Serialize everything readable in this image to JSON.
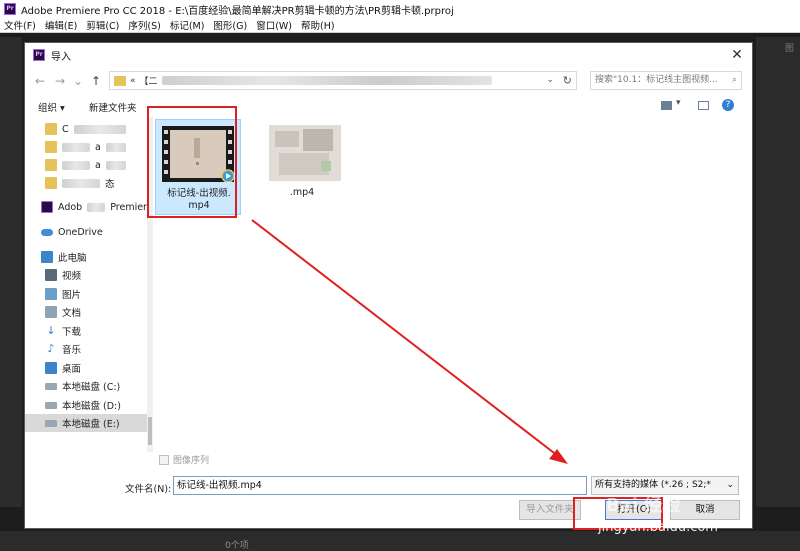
{
  "app": {
    "title": "Adobe Premiere Pro CC 2018 - E:\\百度经验\\最简单解决PR剪辑卡顿的方法\\PR剪辑卡顿.prproj",
    "logo_text": "Pr",
    "menu": [
      "文件(F)",
      "编辑(E)",
      "剪辑(C)",
      "序列(S)",
      "标记(M)",
      "图形(G)",
      "窗口(W)",
      "帮助(H)"
    ],
    "right_label": "图",
    "bottom_label": "0个项"
  },
  "dialog": {
    "title": "导入",
    "close_icon": "close-icon",
    "address_prefix": "«",
    "address_text": "【二",
    "search_placeholder": "搜索\"10.1：标记线主图视频...",
    "toolbar": {
      "organize": "组织 ▾",
      "new_folder": "新建文件夹"
    },
    "sidebar": [
      {
        "label": "C",
        "icon": "folder-icon"
      },
      {
        "label": "a",
        "icon": "folder-icon"
      },
      {
        "label": "a",
        "icon": "folder-icon"
      },
      {
        "label": "态",
        "icon": "folder-icon"
      },
      {
        "label": "Adob",
        "label2": "Premiere",
        "icon": "premiere-icon"
      },
      {
        "label": "OneDrive",
        "icon": "onedrive-icon"
      },
      {
        "label": "此电脑",
        "icon": "pc-icon"
      },
      {
        "label": "视频",
        "icon": "video-icon"
      },
      {
        "label": "图片",
        "icon": "picture-icon"
      },
      {
        "label": "文档",
        "icon": "document-icon"
      },
      {
        "label": "下载",
        "icon": "download-icon"
      },
      {
        "label": "音乐",
        "icon": "music-icon"
      },
      {
        "label": "桌面",
        "icon": "desktop-icon"
      },
      {
        "label": "本地磁盘 (C:)",
        "icon": "disk-icon"
      },
      {
        "label": "本地磁盘 (D:)",
        "icon": "disk-icon"
      },
      {
        "label": "本地磁盘 (E:)",
        "icon": "disk-icon",
        "selected": true
      }
    ],
    "files": [
      {
        "name_line1": "标记线-出视频.",
        "name_line2": "mp4",
        "selected": true
      },
      {
        "name_line1": "",
        "name_line2": ".mp4",
        "selected": false
      }
    ],
    "image_sequence_label": "图像序列",
    "filename_label": "文件名(N):",
    "filename_value": "标记线-出视频.mp4",
    "filetype_value": "所有支持的媒体 (*.26 ;  S2;*",
    "import_folder_button": "导入文件夹",
    "open_button": "打开(O)",
    "cancel_button": "取消"
  },
  "watermark": {
    "text": "jingyan.baidu.com",
    "mark": "Bai 经验"
  },
  "colors": {
    "highlight_red": "#e02020",
    "premiere_purple": "#2a0a45",
    "selection_blue": "#cce8ff"
  }
}
